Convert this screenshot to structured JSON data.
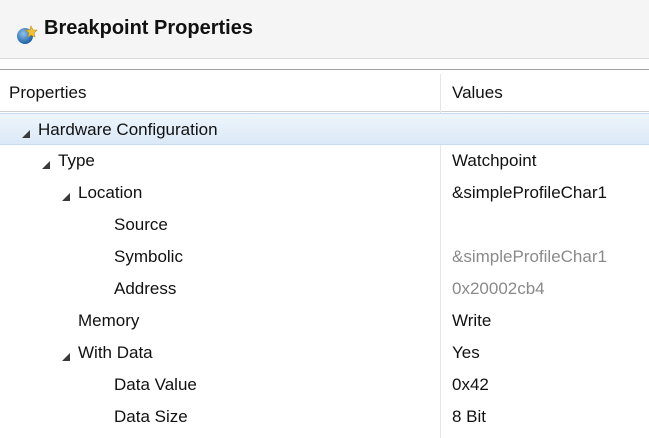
{
  "dialog": {
    "title": "Breakpoint Properties",
    "icon": "breakpoint-properties-icon"
  },
  "table": {
    "headers": {
      "properties": "Properties",
      "values": "Values"
    },
    "rows": [
      {
        "label": "Hardware Configuration",
        "value": "",
        "expanded": true,
        "level": 0,
        "selected": true
      },
      {
        "label": "Type",
        "value": "Watchpoint",
        "expanded": true,
        "level": 1
      },
      {
        "label": "Location",
        "value": "&simpleProfileChar1",
        "expanded": true,
        "level": 2
      },
      {
        "label": "Source",
        "value": "",
        "level": 3
      },
      {
        "label": "Symbolic",
        "value": "&simpleProfileChar1",
        "level": 3,
        "muted": true
      },
      {
        "label": "Address",
        "value": "0x20002cb4",
        "level": 3,
        "muted": true
      },
      {
        "label": "Memory",
        "value": "Write",
        "level": 2
      },
      {
        "label": "With Data",
        "value": "Yes",
        "expanded": true,
        "level": 2
      },
      {
        "label": "Data Value",
        "value": "0x42",
        "level": 3
      },
      {
        "label": "Data Size",
        "value": "8 Bit",
        "level": 3
      }
    ]
  },
  "colors": {
    "selection": "#dbe9f7",
    "muted_text": "#8a8a8a"
  }
}
